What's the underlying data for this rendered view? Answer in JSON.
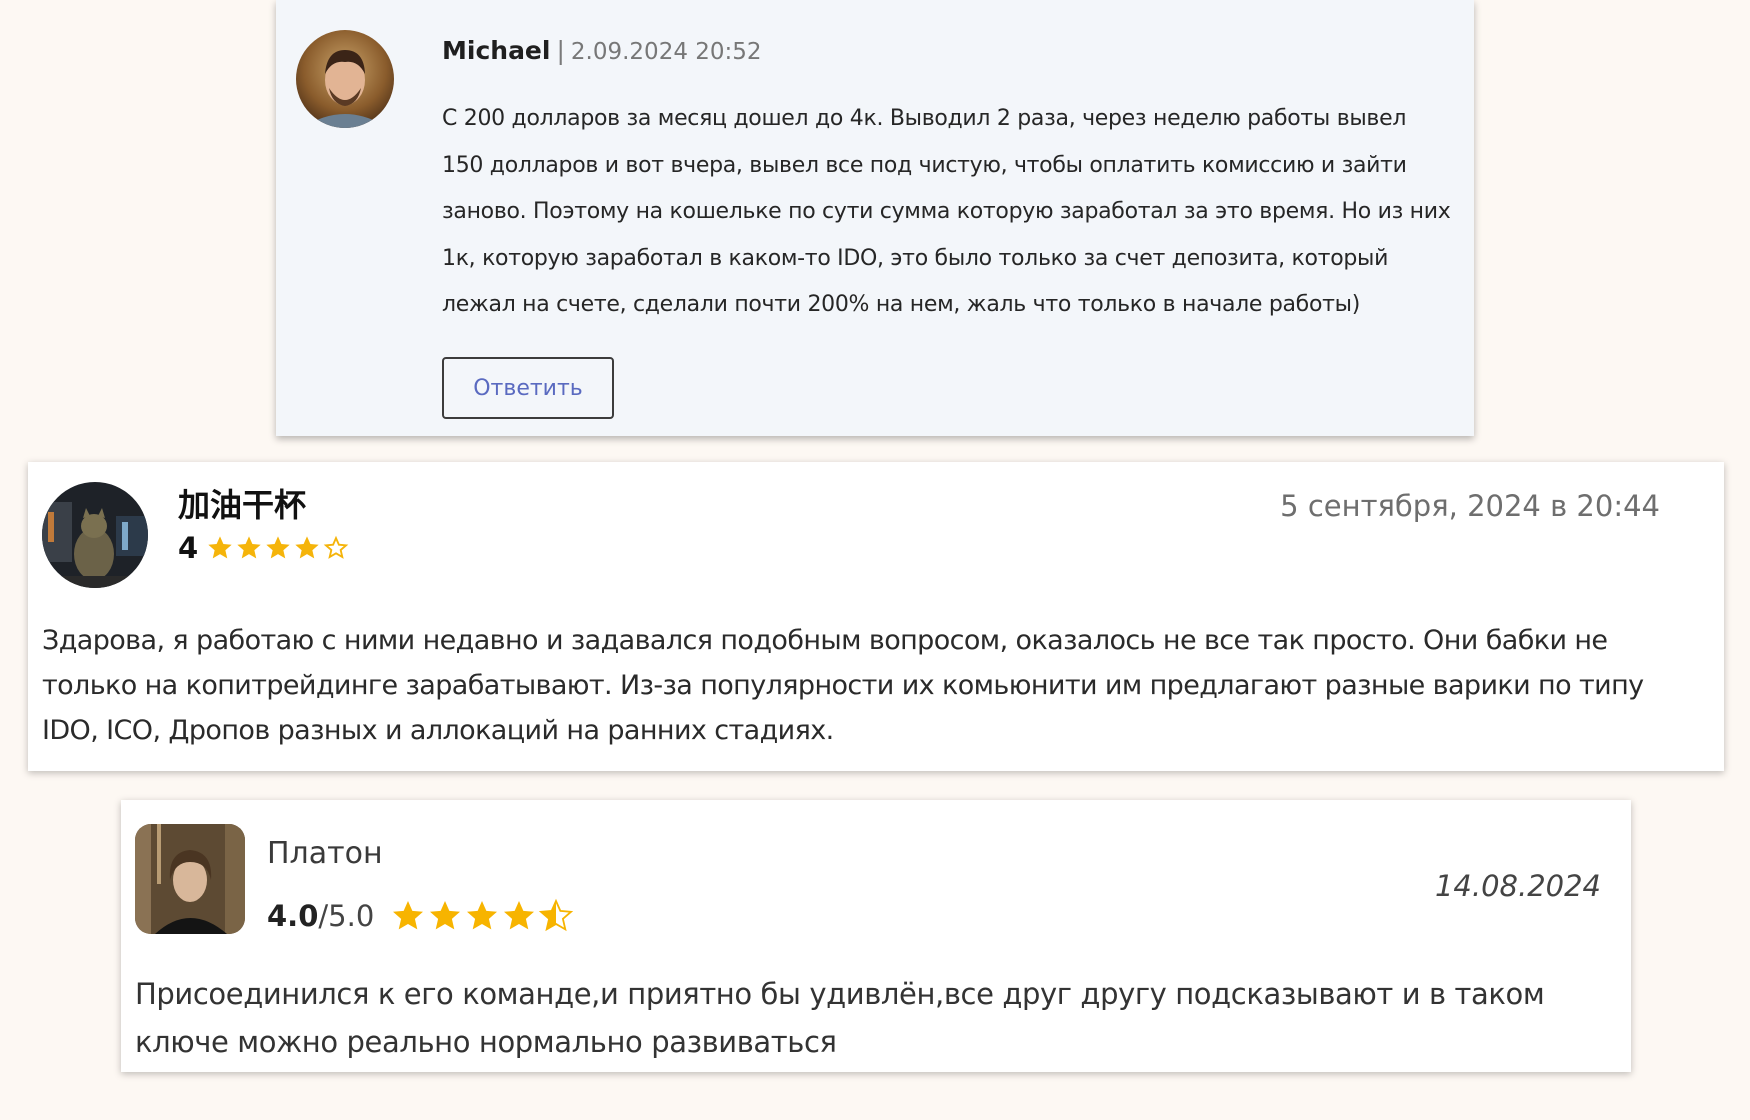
{
  "comment_michael": {
    "author": "Michael",
    "separator": "|",
    "date": "2.09.2024 20:52",
    "text": "С 200 долларов за месяц дошел до 4к. Выводил 2 раза, через неделю работы вывел 150 долларов и вот вчера, вывел все под чистую, чтобы оплатить комиссию и зайти заново. Поэтому на кошельке по сути сумма которую заработал за это время. Но из них 1к, которую заработал в каком-то IDO, это было только за счет депозита, который лежал на счете, сделали почти 200% на нем, жаль что только в начале работы)",
    "reply_label": "Ответить",
    "colors": {
      "background": "#f3f6fa",
      "reply_text": "#5a6ac0"
    }
  },
  "review_jiayou": {
    "author": "加油干杯",
    "rating": "4",
    "stars_filled": 4,
    "stars_total": 5,
    "date": "5 сентября, 2024 в 20:44",
    "text": "Здарова, я работаю с ними недавно и задавался подобным вопросом, оказалось не все так просто. Они бабки не только на копитрейдинге зарабатывают. Из-за популярности их комьюнити им предлагают разные варики по типу IDO, ICO, Дропов разных и аллокаций на ранних стадиях.",
    "colors": {
      "star": "#f5b40a"
    }
  },
  "review_platon": {
    "author": "Платон",
    "rating": "4.0",
    "rating_max": "/5.0",
    "stars_value": 4.5,
    "stars_total": 5,
    "date": "14.08.2024",
    "text": "Присоединился к его команде,и приятно бы удивлён,все друг другу подсказывают и в таком ключе можно реально нормально развиваться",
    "colors": {
      "star": "#f7b400"
    }
  }
}
